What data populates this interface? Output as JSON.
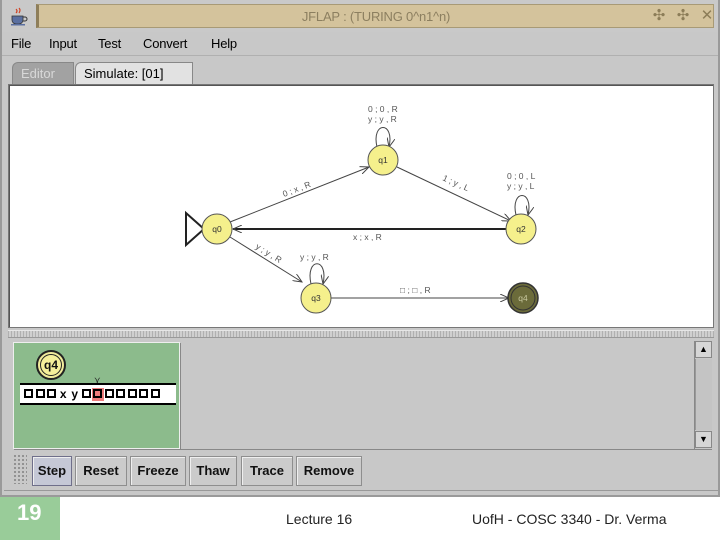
{
  "window": {
    "title": "JFLAP : (TURING 0^n1^n)",
    "app_icon": "java-coffee-cup-icon",
    "controls": [
      "minimize-icon",
      "maximize-icon",
      "close-icon"
    ],
    "control_glyphs": [
      "✣",
      "✣",
      "✕"
    ]
  },
  "menubar": {
    "items": [
      "File",
      "Input",
      "Test",
      "Convert",
      "Help"
    ]
  },
  "tabs": [
    {
      "label": "Editor",
      "active": false
    },
    {
      "label": "Simulate: [01]",
      "active": true
    }
  ],
  "diagram": {
    "states": [
      {
        "id": "q0",
        "label": "q0",
        "initial": true,
        "final": false,
        "current": false
      },
      {
        "id": "q1",
        "label": "q1",
        "initial": false,
        "final": false,
        "current": false
      },
      {
        "id": "q2",
        "label": "q2",
        "initial": false,
        "final": false,
        "current": false
      },
      {
        "id": "q3",
        "label": "q3",
        "initial": false,
        "final": false,
        "current": false
      },
      {
        "id": "q4",
        "label": "q4",
        "initial": false,
        "final": true,
        "current": true
      }
    ],
    "transitions": [
      {
        "from": "q1",
        "to": "q1",
        "labels": [
          "0 ; 0 , R",
          "y ; y , R"
        ]
      },
      {
        "from": "q2",
        "to": "q2",
        "labels": [
          "0 ; 0 , L",
          "y ; y , L"
        ]
      },
      {
        "from": "q0",
        "to": "q1",
        "labels": [
          "0 ; x , R"
        ]
      },
      {
        "from": "q1",
        "to": "q2",
        "labels": [
          "1 ; y , L"
        ]
      },
      {
        "from": "q2",
        "to": "q0",
        "labels": [
          "x ; x , R"
        ]
      },
      {
        "from": "q0",
        "to": "q3",
        "labels": [
          "y ; y , R"
        ]
      },
      {
        "from": "q3",
        "to": "q3",
        "labels": [
          "y ; y , R"
        ]
      },
      {
        "from": "q3",
        "to": "q4",
        "labels": [
          "□ ; □ , R"
        ]
      }
    ],
    "colors": {
      "state_fill": "#f5f08c",
      "final_state_fill": "#6b6b3a",
      "edge": "#444444"
    }
  },
  "simulation": {
    "configurations": [
      {
        "state": "q4",
        "tape": [
          "□",
          "□",
          "□",
          "x",
          "y",
          "□",
          "□",
          "□",
          "□",
          "□",
          "□",
          "□"
        ],
        "head_index": 6
      }
    ],
    "buttons": [
      "Step",
      "Reset",
      "Freeze",
      "Thaw",
      "Trace",
      "Remove"
    ],
    "config_bg": "#8cbb8c"
  },
  "footer": {
    "slide_number": "19",
    "lecture": "Lecture 16",
    "course": "UofH - COSC 3340 - Dr. Verma"
  }
}
